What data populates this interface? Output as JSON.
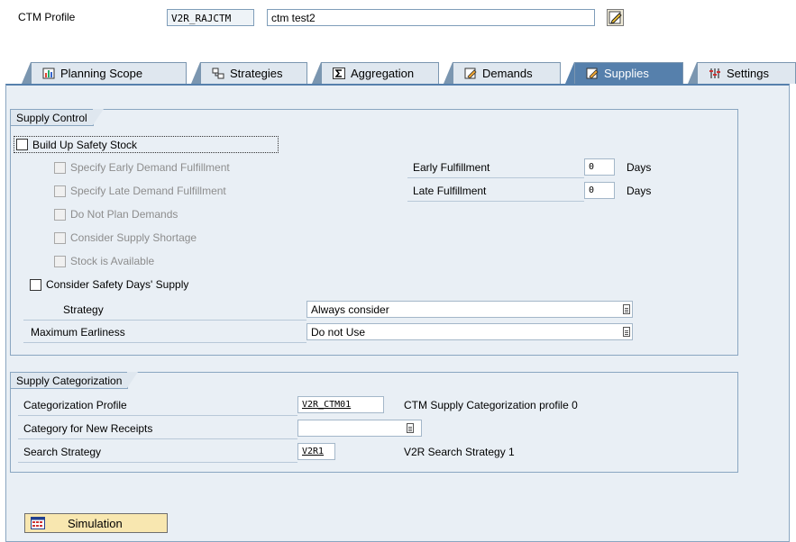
{
  "header": {
    "ctm_profile_label": "CTM Profile",
    "ctm_profile_value": "V2R_RAJCTM",
    "description_value": "ctm test2"
  },
  "tabs": [
    {
      "label": "Planning Scope",
      "icon": "planning-scope-icon",
      "active": false
    },
    {
      "label": "Strategies",
      "icon": "strategies-icon",
      "active": false
    },
    {
      "label": "Aggregation",
      "icon": "sigma-icon",
      "active": false
    },
    {
      "label": "Demands",
      "icon": "demands-icon",
      "active": false
    },
    {
      "label": "Supplies",
      "icon": "supplies-icon",
      "active": true
    },
    {
      "label": "Settings",
      "icon": "settings-icon",
      "active": false
    }
  ],
  "supply_control": {
    "title": "Supply Control",
    "build_up_safety_stock": "Build Up Safety Stock",
    "specify_early": "Specify Early Demand Fulfillment",
    "specify_late": "Specify Late Demand Fulfillment",
    "do_not_plan": "Do Not Plan Demands",
    "consider_shortage": "Consider Supply Shortage",
    "stock_available": "Stock is Available",
    "consider_safety_days": "Consider Safety Days' Supply",
    "early_fulfillment_label": "Early Fulfillment",
    "early_fulfillment_value": "0",
    "late_fulfillment_label": "Late Fulfillment",
    "late_fulfillment_value": "0",
    "days_unit": "Days",
    "strategy_label": "Strategy",
    "strategy_value": "Always consider",
    "max_earliness_label": "Maximum Earliness",
    "max_earliness_value": "Do not Use"
  },
  "supply_categorization": {
    "title": "Supply Categorization",
    "cat_profile_label": "Categorization Profile",
    "cat_profile_value": "V2R_CTM01",
    "cat_profile_desc": "CTM Supply Categorization profile 0",
    "new_receipts_label": "Category for New Receipts",
    "new_receipts_value": "",
    "search_strategy_label": "Search Strategy",
    "search_strategy_value": "V2R1",
    "search_strategy_desc": "V2R Search Strategy 1"
  },
  "simulation_button": "Simulation",
  "colors": {
    "active_tab": "#5680ac",
    "tab_bg": "#dfe7ef",
    "content_bg": "#e9eff5",
    "button_bg": "#f8e7b0"
  }
}
